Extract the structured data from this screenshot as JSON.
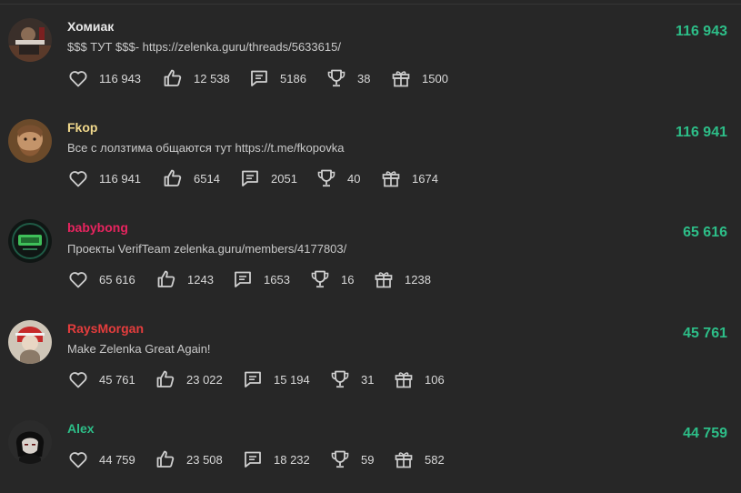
{
  "colors": {
    "background": "#272727",
    "score": "#2dbe88",
    "username_default": "#e8e8e8",
    "username_gold": "#f1d98c",
    "username_pink": "#e8245f",
    "username_red": "#e53d3d",
    "username_green": "#2dbe88",
    "icon": "#cfcfcf"
  },
  "icons": [
    "heart-icon",
    "thumbs-up-icon",
    "comment-icon",
    "trophy-icon",
    "gift-icon"
  ],
  "users": [
    {
      "name": "Хомиак",
      "status": "$$$ ТУТ $$$- https://zelenka.guru/threads/5633615/",
      "score": "116 943",
      "likes": "116 943",
      "thumbs": "12 538",
      "messages": "5186",
      "trophies": "38",
      "gifts": "1500"
    },
    {
      "name": "Fkop",
      "status": "Все с лолзтима общаются тут https://t.me/fkopovka",
      "score": "116 941",
      "likes": "116 941",
      "thumbs": "6514",
      "messages": "2051",
      "trophies": "40",
      "gifts": "1674"
    },
    {
      "name": "babybong",
      "status": "Проекты VerifTeam zelenka.guru/members/4177803/",
      "score": "65 616",
      "likes": "65 616",
      "thumbs": "1243",
      "messages": "1653",
      "trophies": "16",
      "gifts": "1238"
    },
    {
      "name": "RaysMorgan",
      "status": "Make Zelenka Great Again!",
      "score": "45 761",
      "likes": "45 761",
      "thumbs": "23 022",
      "messages": "15 194",
      "trophies": "31",
      "gifts": "106"
    },
    {
      "name": "Alex",
      "status": "",
      "score": "44 759",
      "likes": "44 759",
      "thumbs": "23 508",
      "messages": "18 232",
      "trophies": "59",
      "gifts": "582"
    }
  ]
}
